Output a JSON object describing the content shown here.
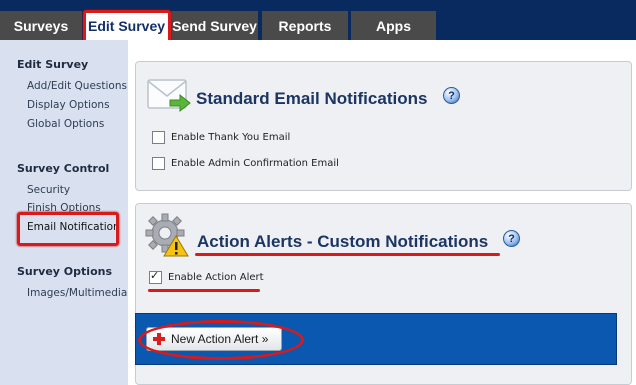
{
  "tabs": [
    {
      "label": "Surveys"
    },
    {
      "label": "Edit Survey",
      "active": true
    },
    {
      "label": "Send Survey"
    },
    {
      "label": "Reports"
    },
    {
      "label": "Apps"
    }
  ],
  "sidebar": {
    "edit_survey": {
      "heading": "Edit Survey",
      "links": [
        "Add/Edit Questions",
        "Display Options",
        "Global Options"
      ]
    },
    "survey_control": {
      "heading": "Survey Control",
      "links": [
        "Security",
        "Finish Options",
        "Email Notification"
      ]
    },
    "survey_options": {
      "heading": "Survey Options",
      "links": [
        "Images/Multimedia"
      ]
    }
  },
  "standard_panel": {
    "title": "Standard Email Notifications",
    "help": "?",
    "options": [
      {
        "label": "Enable Thank You Email",
        "checked": false
      },
      {
        "label": "Enable Admin Confirmation Email",
        "checked": false
      }
    ]
  },
  "action_panel": {
    "title": "Action Alerts - Custom Notifications",
    "help": "?",
    "option": {
      "label": "Enable Action Alert",
      "checked": true
    },
    "new_button": "New Action Alert »"
  },
  "colors": {
    "header_bg": "#082a5e",
    "tab_bg": "#4a4a4a",
    "active_tab_text": "#14306a",
    "sidebar_bg": "#d9e1f0",
    "panel_bg": "#eef0f3",
    "panel_title": "#1d3563",
    "action_bar": "#0a58b0",
    "highlight": "#d91a1a"
  }
}
